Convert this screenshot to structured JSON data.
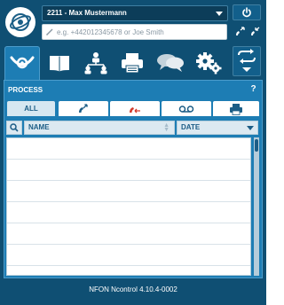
{
  "header": {
    "user": "2211 - Max Mustermann",
    "dial_placeholder": "e.g. +442012345678 or Joe Smith"
  },
  "tabs": [
    {
      "name": "process",
      "icon": "horn-icon"
    },
    {
      "name": "phonebook",
      "icon": "book-icon"
    },
    {
      "name": "organization",
      "icon": "org-chart-icon"
    },
    {
      "name": "fax",
      "icon": "fax-icon"
    },
    {
      "name": "chat",
      "icon": "chat-icon"
    },
    {
      "name": "settings",
      "icon": "gears-icon"
    }
  ],
  "panel": {
    "title": "PROCESS",
    "help": "?",
    "filters": [
      {
        "label": "ALL",
        "icon": ""
      },
      {
        "label": "",
        "icon": "outgoing-call-icon"
      },
      {
        "label": "",
        "icon": "missed-call-icon"
      },
      {
        "label": "",
        "icon": "voicemail-icon"
      },
      {
        "label": "",
        "icon": "fax-icon"
      }
    ],
    "columns": {
      "name": "NAME",
      "date": "DATE"
    },
    "rows": 7
  },
  "footer": {
    "version": "NFON Ncontrol 4.10.4-0002"
  },
  "colors": {
    "background": "#0f4f73",
    "panel": "#1d7db4",
    "header_strip": "#dce9f1",
    "missed_call": "#d33a2c",
    "accent_text": "#1c5d86"
  }
}
